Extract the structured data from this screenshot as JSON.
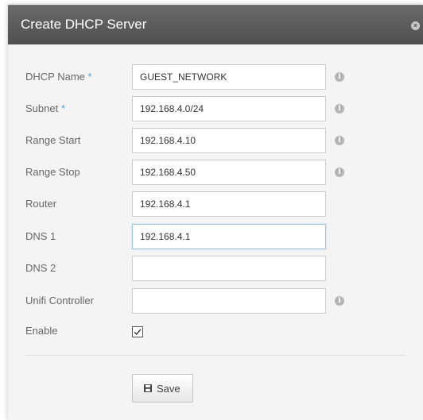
{
  "dialog": {
    "title": "Create DHCP Server",
    "close_icon": "×"
  },
  "fields": {
    "dhcp_name": {
      "label": "DHCP Name",
      "required_mark": "*",
      "value": "GUEST_NETWORK"
    },
    "subnet": {
      "label": "Subnet",
      "required_mark": "*",
      "value": "192.168.4.0/24"
    },
    "range_start": {
      "label": "Range Start",
      "value": "192.168.4.10"
    },
    "range_stop": {
      "label": "Range Stop",
      "value": "192.168.4.50"
    },
    "router": {
      "label": "Router",
      "value": "192.168.4.1"
    },
    "dns1": {
      "label": "DNS 1",
      "value": "192.168.4.1"
    },
    "dns2": {
      "label": "DNS 2",
      "value": ""
    },
    "unifi_controller": {
      "label": "Unifi Controller",
      "value": ""
    },
    "enable": {
      "label": "Enable",
      "checked": true
    }
  },
  "info_icon": "i",
  "actions": {
    "save_label": "Save"
  },
  "colors": {
    "titlebar": "#555555",
    "required": "#4a9fd8",
    "info_icon": "#b5b5b5",
    "background": "#f4f4f4"
  }
}
